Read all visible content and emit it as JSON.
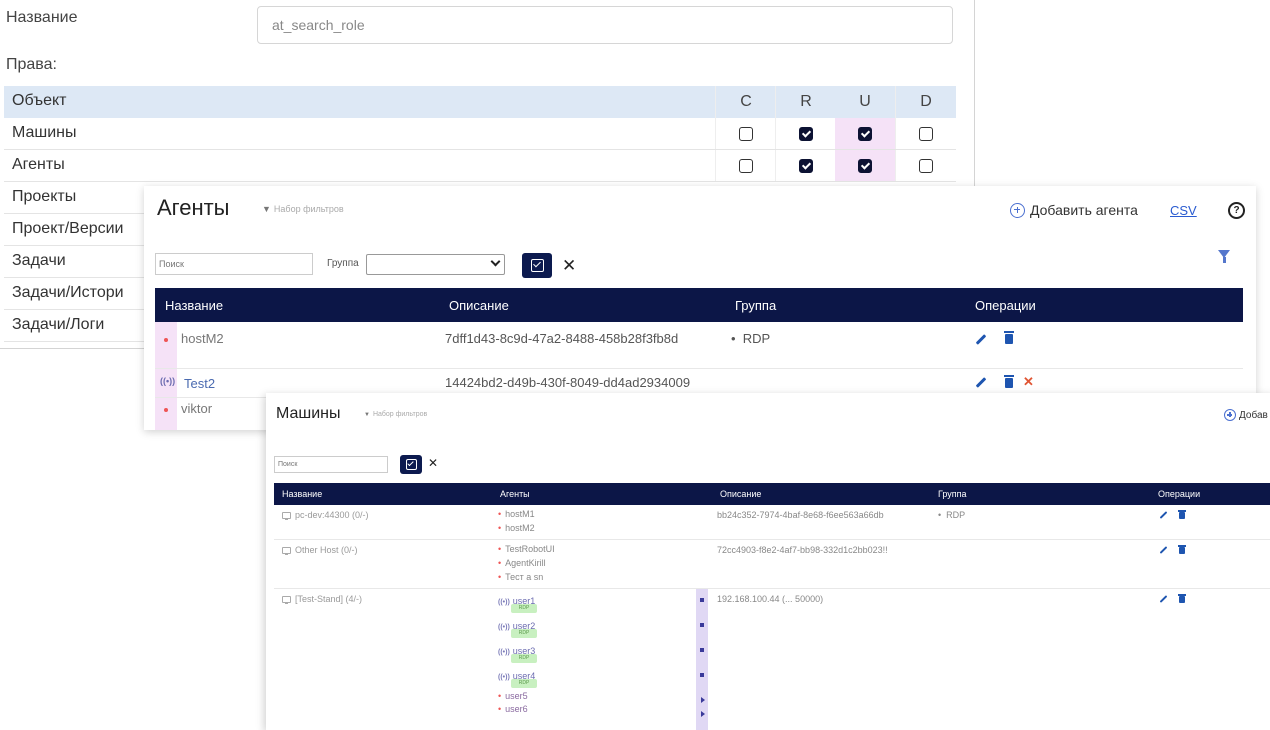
{
  "role_form": {
    "name_label": "Название",
    "name_value": "at_search_role",
    "rights_label": "Права:",
    "rights_table": {
      "headers": {
        "object": "Объект",
        "c": "C",
        "r": "R",
        "u": "U",
        "d": "D"
      },
      "rows": [
        {
          "object": "Машины",
          "c": false,
          "r": true,
          "u": true,
          "d": false
        },
        {
          "object": "Агенты",
          "c": false,
          "r": true,
          "u": true,
          "d": false
        },
        {
          "object": "Проекты"
        },
        {
          "object": "Проект/Версии"
        },
        {
          "object": "Задачи"
        },
        {
          "object": "Задачи/Истори"
        },
        {
          "object": "Задачи/Логи"
        }
      ]
    }
  },
  "agents_panel": {
    "title": "Агенты",
    "filter_set": "Набор фильтров",
    "add_button": "Добавить агента",
    "csv_link": "CSV",
    "help_icon": "?",
    "search_placeholder": "Поиск",
    "group_label": "Группа",
    "clear_icon": "✕",
    "columns": [
      "Название",
      "Описание",
      "Группа",
      "Операции"
    ],
    "rows": [
      {
        "name": "hostM2",
        "description": "7dff1d43-8c9d-47a2-8488-458b28f3fb8d",
        "group": "RDP"
      },
      {
        "name": "Test2",
        "description": "14424bd2-d49b-430f-8049-dd4ad2934009",
        "group": ""
      },
      {
        "name": "viktor",
        "description": "",
        "group": ""
      }
    ]
  },
  "machines_panel": {
    "title": "Машины",
    "filter_set": "Набор фильтров",
    "add_button": "Добав",
    "search_placeholder": "Поиск",
    "clear_icon": "✕",
    "columns": [
      "Название",
      "Агенты",
      "Описание",
      "Группа",
      "Операции"
    ],
    "rows": [
      {
        "name": "pc-dev:44300 (0/-)",
        "agents": [
          "hostM1",
          "hostM2"
        ],
        "description": "bb24c352-7974-4baf-8e68-f6ee563a66db",
        "group": "RDP"
      },
      {
        "name": "Other Host (0/-)",
        "agents": [
          "TestRobotUI",
          "AgentKirill",
          "Тест a sn"
        ],
        "description": "72cc4903-f8e2-4af7-bb98-332d1c2bb023!!",
        "group": ""
      },
      {
        "name": "[Test-Stand] (4/-)",
        "description": "192.168.100.44 (... 50000)",
        "group": "",
        "user_agents": [
          {
            "name": "user1",
            "badge": "RDP"
          },
          {
            "name": "user2",
            "badge": "RDP"
          },
          {
            "name": "user3",
            "badge": "RDP"
          },
          {
            "name": "user4",
            "badge": "RDP"
          },
          {
            "name": "user5"
          },
          {
            "name": "user6"
          }
        ]
      }
    ]
  },
  "colors": {
    "header_navy": "#0c1647",
    "accent_blue": "#1e55b0",
    "highlight_pink": "#f5e2f7",
    "table_head_blue": "#dde8f5",
    "delete_red": "#e05533"
  }
}
